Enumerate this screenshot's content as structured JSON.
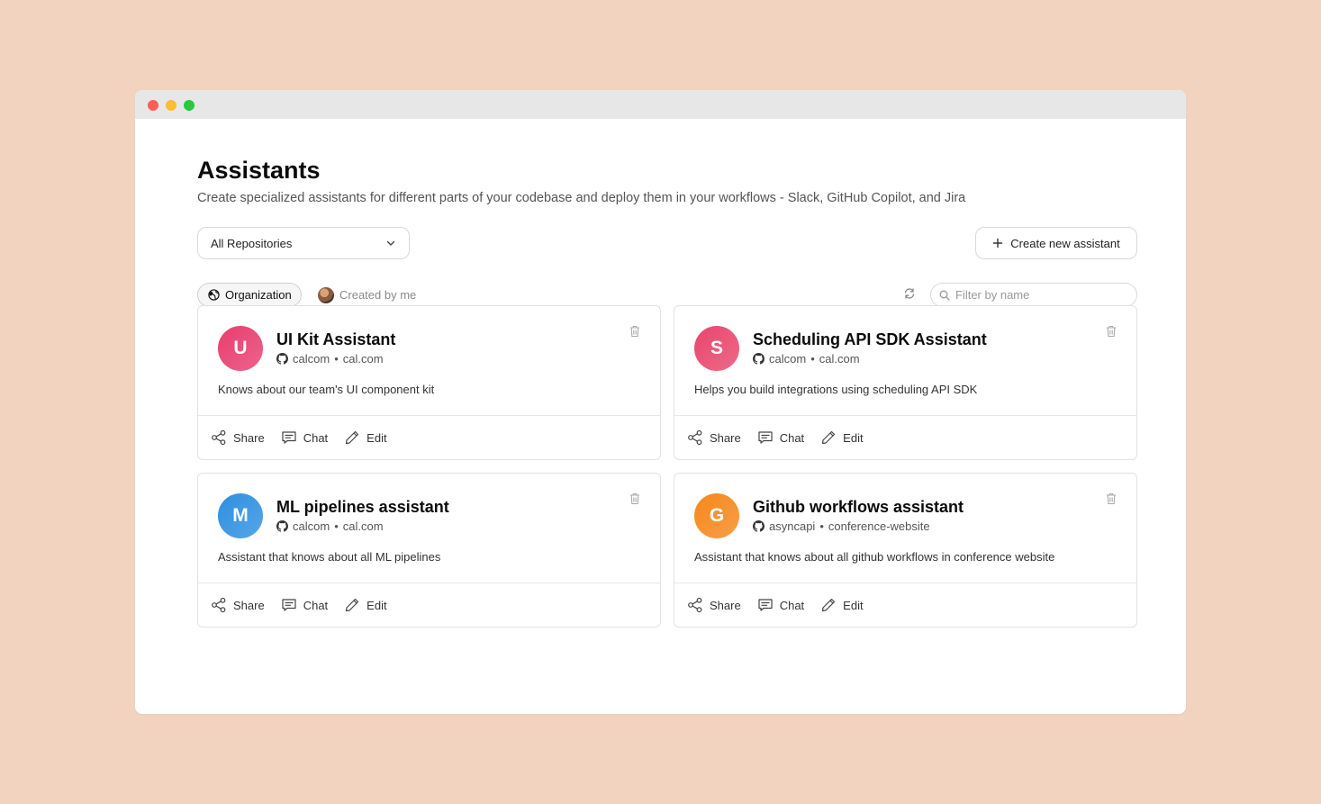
{
  "page": {
    "title": "Assistants",
    "subtitle": "Create specialized assistants for different parts of your codebase and deploy them in your workflows - Slack, GitHub Copilot, and Jira"
  },
  "toolbar": {
    "repo_select": "All Repositories",
    "create_label": "Create new assistant"
  },
  "filters": {
    "organization": "Organization",
    "created_by_me": "Created by me",
    "search_placeholder": "Filter by name"
  },
  "actions": {
    "share": "Share",
    "chat": "Chat",
    "edit": "Edit"
  },
  "cards": [
    {
      "initial": "U",
      "name": "UI Kit Assistant",
      "owner": "calcom",
      "sep": "•",
      "repo": "cal.com",
      "description": "Knows about our team's UI component kit",
      "color": "#e83d6f"
    },
    {
      "initial": "S",
      "name": "Scheduling API SDK Assistant",
      "owner": "calcom",
      "sep": "•",
      "repo": "cal.com",
      "description": "Helps you build integrations using scheduling API SDK",
      "color": "#e8456c"
    },
    {
      "initial": "M",
      "name": "ML pipelines assistant",
      "owner": "calcom",
      "sep": "•",
      "repo": "cal.com",
      "description": "Assistant that knows about all ML pipelines",
      "color": "#2d8fe0"
    },
    {
      "initial": "G",
      "name": "Github workflows assistant",
      "owner": "asyncapi",
      "sep": "•",
      "repo": "conference-website",
      "description": "Assistant that knows about all github workflows in conference website",
      "color": "#f5871a"
    }
  ]
}
